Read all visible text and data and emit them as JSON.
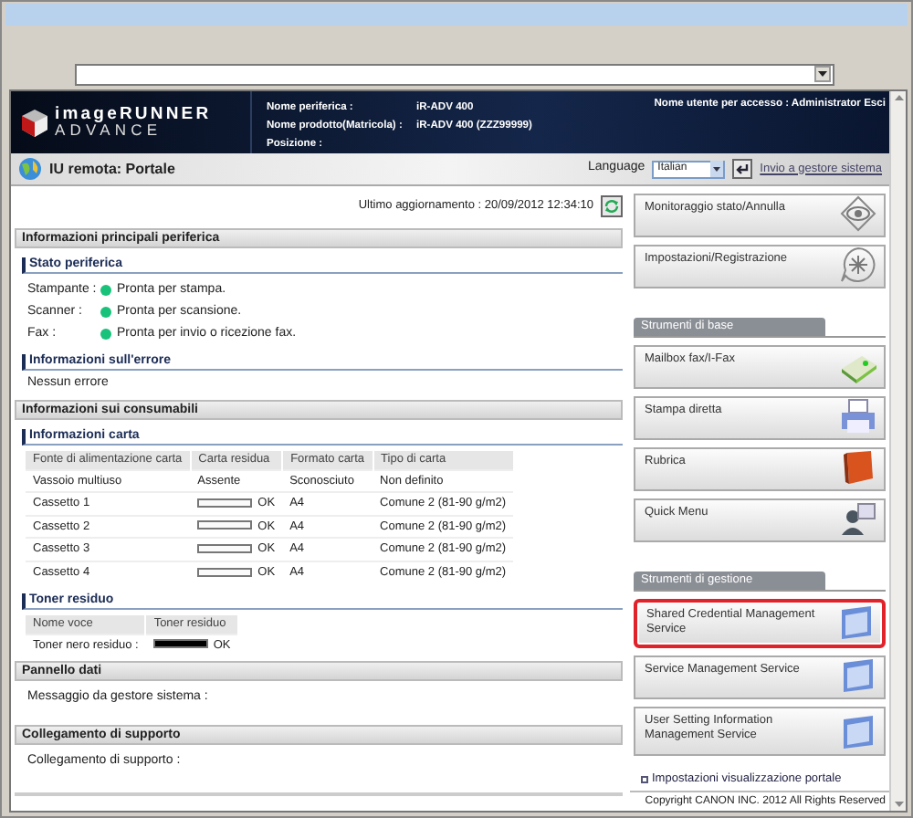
{
  "header": {
    "logo_line1": "imageRUNNER",
    "logo_line2": "ADVANCE",
    "fields": [
      {
        "label": "Nome periferica :",
        "value": "iR-ADV 400"
      },
      {
        "label": "Nome prodotto(Matricola) :",
        "value": "iR-ADV 400 (ZZZ99999)"
      },
      {
        "label": "Posizione :"
      }
    ],
    "user": "Nome utente per accesso : Administrator",
    "logout": "Esci"
  },
  "subheader": {
    "title": "IU remota: Portale",
    "language_label": "Language",
    "language": "Italian",
    "link": "Invio a gestore sistema"
  },
  "last_update": "Ultimo aggiornamento : 20/09/2012 12:34:10",
  "device": {
    "title": "Informazioni principali periferica",
    "status": {
      "title": "Stato periferica",
      "rows": [
        {
          "label": "Stampante :",
          "value": "Pronta per stampa.",
          "color": "#19c27a"
        },
        {
          "label": "Scanner :",
          "value": "Pronta per scansione.",
          "color": "#19c27a"
        },
        {
          "label": "Fax :",
          "value": "Pronta per invio o ricezione fax.",
          "color": "#19c27a"
        }
      ]
    },
    "error": {
      "title": "Informazioni sull'errore",
      "text": "Nessun errore"
    }
  },
  "consumables": {
    "title": "Informazioni sui consumabili",
    "paper": {
      "title": "Informazioni carta",
      "columns": [
        "Fonte di alimentazione carta",
        "Carta residua",
        "Formato carta",
        "Tipo di carta"
      ],
      "rows": [
        {
          "source": "Vassoio multiuso",
          "remaining": "Assente",
          "size": "Sconosciuto",
          "type": "Non definito"
        },
        {
          "source": "Cassetto 1",
          "level": 1,
          "remaining": "OK",
          "size": "A4",
          "type": "Comune 2 (81-90 g/m2)"
        },
        {
          "source": "Cassetto 2",
          "level": 1,
          "remaining": "OK",
          "size": "A4",
          "type": "Comune 2 (81-90 g/m2)"
        },
        {
          "source": "Cassetto 3",
          "level": 1,
          "remaining": "OK",
          "size": "A4",
          "type": "Comune 2 (81-90 g/m2)"
        },
        {
          "source": "Cassetto 4",
          "level": 1,
          "remaining": "OK",
          "size": "A4",
          "type": "Comune 2 (81-90 g/m2)"
        }
      ]
    },
    "toner": {
      "title": "Toner residuo",
      "columns": [
        "Nome voce",
        "Toner residuo"
      ],
      "rows": [
        {
          "name": "Toner nero residuo :",
          "level": 1,
          "remaining": "OK"
        }
      ]
    }
  },
  "panel": {
    "title": "Pannello dati",
    "text": "Messaggio da gestore sistema :"
  },
  "support": {
    "title": "Collegamento di supporto",
    "text": "Collegamento di supporto :"
  },
  "tool_groups": [
    {
      "items": [
        {
          "label": "Monitoraggio stato/Annulla",
          "selected": false
        },
        {
          "label": "Impostazioni/Registrazione",
          "selected": false
        }
      ]
    },
    {
      "title": "Strumenti di base",
      "items": [
        {
          "label": "Mailbox fax/I-Fax",
          "selected": false
        },
        {
          "label": "Stampa diretta",
          "selected": false
        },
        {
          "label": "Rubrica",
          "selected": false
        },
        {
          "label": "Quick Menu",
          "selected": false
        }
      ]
    },
    {
      "title": "Strumenti di gestione",
      "items": [
        {
          "label": "Shared Credential Management Service",
          "selected": true
        },
        {
          "label": "Service Management Service",
          "selected": false
        },
        {
          "label": "User Setting Information Management Service",
          "selected": false
        }
      ]
    }
  ],
  "portal_link": "Impostazioni visualizzazione portale",
  "copyright": "Copyright CANON INC. 2012 All Rights Reserved"
}
